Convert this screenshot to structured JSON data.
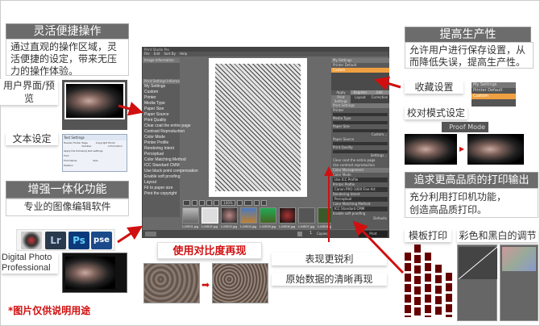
{
  "left": {
    "flex_title": "灵活便捷操作",
    "flex_body": "通过直观的操作区域，灵活便捷的设定，带来无压力的操作体验。",
    "ui_preview_label": "用户界面/预览",
    "text_settings_label": "文本设定",
    "text_settings_dialog": {
      "title": "Text Settings",
      "tabs": [
        "Header",
        "Footer",
        "Page Number",
        "Copyright",
        "Photo Information"
      ],
      "checkbox": "Apply the following text settings",
      "font": "Font",
      "font_name": "Font Name",
      "size": "Size",
      "position": "Position"
    },
    "integrate_title": "增强一体化功能",
    "integrate_body": "专业的图像编辑软件",
    "apps": [
      "Lr",
      "Ps",
      "pse"
    ],
    "dpp_label": "Digital Photo Professional",
    "disclaimer": "*图片仅供说明用途"
  },
  "app": {
    "title": "Print Studio Pro",
    "menu": [
      "File",
      "Edit",
      "Sort By",
      "Help"
    ],
    "left_panel": {
      "image_info_header": "Image Information",
      "print_info_header": "Print Settings Information",
      "items": [
        "My Settings",
        "Custom",
        "Printer",
        "Media Type",
        "Paper Size",
        "Paper Source",
        "Print Quality",
        "Clear coat the entire page",
        "Contrast Reproduction",
        "Color Mode",
        "Printer Profile",
        "Rendering Intent",
        "Perceptual",
        "Color Matching Method",
        "ICC Standard CMM",
        "Use black point compensation",
        "Enable soft proofing",
        "Layout",
        "Fit to paper size",
        "Print the copyright"
      ]
    },
    "zoom_value": "100%",
    "thumbnails": [
      "1-MS01.jpg",
      "1-MS02.jpg",
      "1-MS03.jpg",
      "1-MS04.jpg",
      "1-MS05.jpg",
      "1-MS06.jpg",
      "1-MS07.jpg",
      "1-MS08.jpg"
    ],
    "right_panel": {
      "my_settings_header": "My Settings",
      "settings_list": [
        "Printer Default",
        "Custom"
      ],
      "buttons": [
        "Apply",
        "Register",
        "Edit"
      ],
      "tabs": [
        "Print Settings",
        "Layout",
        "Correction"
      ],
      "print_settings_header": "Print Settings",
      "fields": [
        "Printer",
        "Media Type",
        "Paper Size",
        "Paper Source",
        "Print Quality"
      ],
      "custom_btn": "Custom...",
      "settings_btn": "Settings...",
      "checks": [
        "Clear coat the entire page",
        "Use contrast reproduction"
      ],
      "color_header": "Color Management",
      "color_fields": [
        "Color Mode",
        "Printer Profile",
        "Rendering Intent",
        "Color Matching Method"
      ],
      "color_values": [
        "Use ICC Profile",
        "Canon PRO-1000 Fine Art",
        "Perceptual",
        "ICC Standard CMM"
      ],
      "soft_proof": "Enable soft proofing",
      "defaults_btn": "Defaults",
      "copies_label": "Copies",
      "copies_value": "1",
      "print_btn": "Print"
    }
  },
  "bottom": {
    "contrast_title": "使用对比度再现",
    "sharper": "表现更锐利",
    "clear_repro": "原始数据的清晰再现"
  },
  "right": {
    "prod_title": "提高生产性",
    "prod_body": "允许用户进行保存设置，从而降低失误，提高生产性。",
    "fav_label": "收藏设置",
    "fav_widget": {
      "header": "My Settings",
      "items": [
        "Printer Default",
        "Custom"
      ]
    },
    "proof_label": "校对模式设定",
    "proof_button": "Proof Mode",
    "quality_title": "追求更高品质的打印输出",
    "quality_body_1": "充分利用打印机功能，",
    "quality_body_2": "创造高品质打印。",
    "template_label": "模板打印",
    "color_bw_label": "彩色和黑白的调节"
  },
  "colors": {
    "header_gray": "#6c6c6c",
    "accent_red": "#d01010",
    "custom_orange": "#f0a040"
  }
}
